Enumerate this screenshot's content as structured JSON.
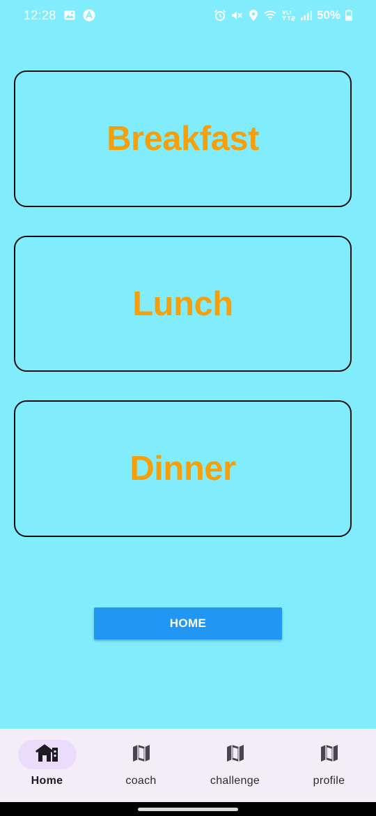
{
  "status_bar": {
    "time": "12:28",
    "battery": "50%",
    "icons": [
      "image-icon",
      "app-notification-icon",
      "alarm-icon",
      "mute-icon",
      "location-icon",
      "wifi-icon",
      "volte-icon",
      "signal-icon",
      "battery-icon"
    ]
  },
  "meals": {
    "breakfast": "Breakfast",
    "lunch": "Lunch",
    "dinner": "Dinner",
    "label_color": "#f5a00a"
  },
  "home_button": {
    "label": "HOME",
    "color": "#2196f3"
  },
  "bottom_nav": {
    "items": [
      {
        "label": "Home",
        "icon": "home-icon",
        "active": true
      },
      {
        "label": "coach",
        "icon": "map-icon",
        "active": false
      },
      {
        "label": "challenge",
        "icon": "map-icon",
        "active": false
      },
      {
        "label": "profile",
        "icon": "map-icon",
        "active": false
      }
    ],
    "active_indicator_color": "#e9ddfb"
  },
  "colors": {
    "background": "#81ecfc",
    "nav_background": "#f2edf6"
  }
}
